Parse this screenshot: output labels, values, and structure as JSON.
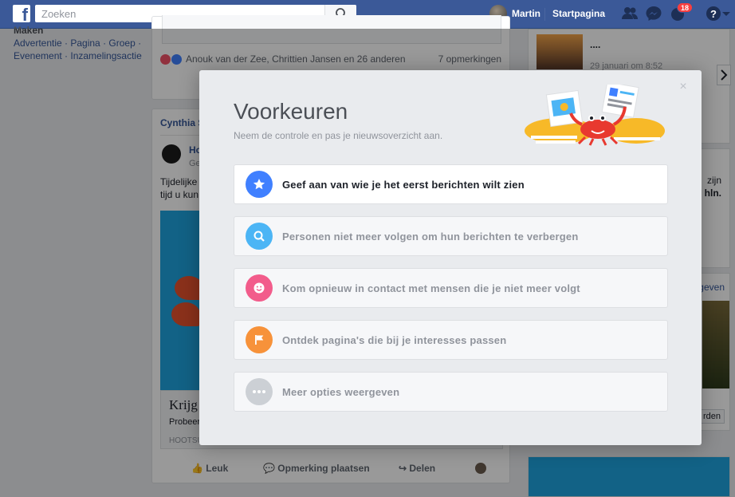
{
  "topbar": {
    "logo": "f",
    "search_placeholder": "Zoeken",
    "user_name": "Martin",
    "home_label": "Startpagina",
    "notification_count": "18"
  },
  "left_nav": {
    "header": "Maken",
    "line1": "Advertentie · Pagina · Groep ·",
    "line2": "Evenement · Inzamelingsactie"
  },
  "feed": {
    "post1_reactions": "Anouk van der Zee, Chrittien Jansen en 26 anderen",
    "post1_comments": "7 opmerkingen",
    "post2_author": "Cynthia S",
    "post2_page": "Ho",
    "post2_sub": "Ge",
    "post2_text1": "Tijdelijke",
    "post2_text2": "tijd u kun",
    "post2_link_title": "Krijg",
    "post2_link_sub": "Probeer",
    "post2_link_domain": "HOOTSU",
    "actions": {
      "like": "Leuk",
      "comment": "Opmerking plaatsen",
      "share": "Delen"
    }
  },
  "right_col": {
    "item_title": "....",
    "item_date": "29 januari om 8:52",
    "snippet1": "zijn",
    "snippet2": "hln.",
    "snippet3": "ergeven",
    "button": "rden"
  },
  "dialog": {
    "title": "Voorkeuren",
    "subtitle": "Neem de controle en pas je nieuwsoverzicht aan.",
    "close": "×",
    "options": [
      {
        "label": "Geef aan van wie je het eerst berichten wilt zien",
        "icon": "star-icon",
        "color": "#4080ff"
      },
      {
        "label": "Personen niet meer volgen om hun berichten te verbergen",
        "icon": "search-icon",
        "color": "#4cb5f5"
      },
      {
        "label": "Kom opnieuw in contact met mensen die je niet meer volgt",
        "icon": "smiley-icon",
        "color": "#f25c8b"
      },
      {
        "label": "Ontdek pagina's die bij je interesses passen",
        "icon": "flag-icon",
        "color": "#f7923a"
      },
      {
        "label": "Meer opties weergeven",
        "icon": "more-icon",
        "color": "#ccd0d5"
      }
    ]
  }
}
